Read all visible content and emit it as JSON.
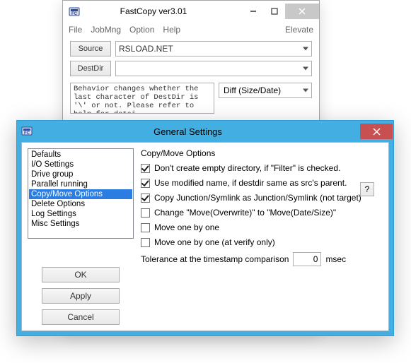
{
  "main_window": {
    "title": "FastCopy ver3.01",
    "menu": {
      "file": "File",
      "jobmng": "JobMng",
      "option": "Option",
      "help": "Help",
      "elevate": "Elevate"
    },
    "source_label": "Source",
    "source_value": "RSLOAD.NET",
    "destdir_label": "DestDir",
    "destdir_value": "",
    "behavior_text": "Behavior changes whether the last character of DestDir is '\\' or not. Please refer to help for detai",
    "diff_label": "Diff (Size/Date)"
  },
  "dialog": {
    "title": "General Settings",
    "list": [
      "Defaults",
      "I/O Settings",
      "Drive group",
      "Parallel running",
      "Copy/Move Options",
      "Delete Options",
      "Log Settings",
      "Misc Settings"
    ],
    "selected_index": 4,
    "buttons": {
      "ok": "OK",
      "apply": "Apply",
      "cancel": "Cancel",
      "help": "?"
    },
    "group_title": "Copy/Move Options",
    "checks": {
      "c1": {
        "label": "Don't create empty directory, if \"Filter\" is checked.",
        "checked": true
      },
      "c2": {
        "label": "Use modified name, if destdir same as src's parent.",
        "checked": true
      },
      "c3": {
        "label": "Copy Junction/Symlink as Junction/Symlink (not target)",
        "checked": true
      },
      "c4": {
        "label": "Change \"Move(Overwrite)\" to \"Move(Date/Size)\"",
        "checked": false
      },
      "c5": {
        "label": "Move one by one",
        "checked": false
      },
      "c6": {
        "label": "Move one by one (at verify only)",
        "checked": false
      }
    },
    "tolerance_label": "Tolerance at the timestamp comparison",
    "tolerance_value": "0",
    "tolerance_unit": "msec"
  }
}
